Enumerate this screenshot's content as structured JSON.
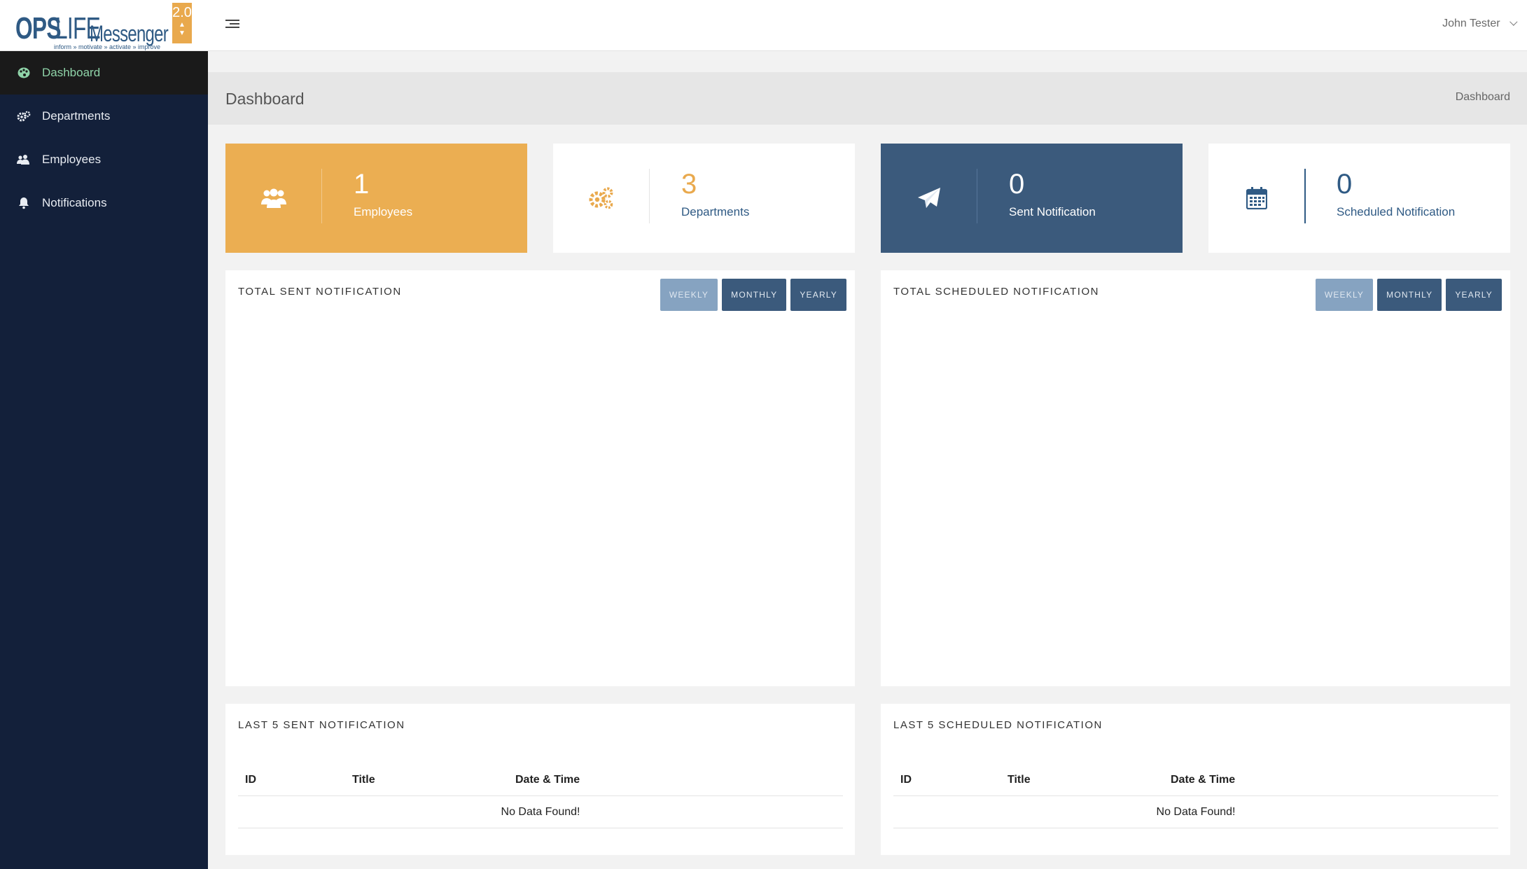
{
  "app": {
    "logo": {
      "ops": "OPS",
      "life": "LIFE",
      "messenger": "Messenger",
      "tagline": "inform » motivate » activate » improve",
      "version": "2.0"
    },
    "user_name": "John Tester"
  },
  "sidebar": {
    "items": [
      {
        "label": "Dashboard",
        "icon": "palette-icon",
        "active": true
      },
      {
        "label": "Departments",
        "icon": "gears-icon",
        "active": false
      },
      {
        "label": "Employees",
        "icon": "users-icon",
        "active": false
      },
      {
        "label": "Notifications",
        "icon": "bell-icon",
        "active": false
      }
    ]
  },
  "page": {
    "title": "Dashboard",
    "breadcrumb": "Dashboard"
  },
  "stats": [
    {
      "value": "1",
      "label": "Employees",
      "icon": "users-icon",
      "color": "#ebae52"
    },
    {
      "value": "3",
      "label": "Departments",
      "icon": "gears-icon",
      "color": "#ffffff"
    },
    {
      "value": "0",
      "label": "Sent Notification",
      "icon": "paper-plane-icon",
      "color": "#3b5a7c"
    },
    {
      "value": "0",
      "label": "Scheduled Notification",
      "icon": "calendar-icon",
      "color": "#ffffff"
    }
  ],
  "charts": {
    "sent": {
      "title": "TOTAL SENT NOTIFICATION",
      "buttons": [
        "WEEKLY",
        "MONTHLY",
        "YEARLY"
      ]
    },
    "scheduled": {
      "title": "TOTAL SCHEDULED NOTIFICATION",
      "buttons": [
        "WEEKLY",
        "MONTHLY",
        "YEARLY"
      ]
    }
  },
  "tables": {
    "sent": {
      "title": "LAST 5 SENT NOTIFICATION",
      "columns": [
        "ID",
        "Title",
        "Date & Time"
      ],
      "empty": "No Data Found!"
    },
    "scheduled": {
      "title": "LAST 5 SCHEDULED NOTIFICATION",
      "columns": [
        "ID",
        "Title",
        "Date & Time"
      ],
      "empty": "No Data Found!"
    }
  },
  "colors": {
    "sidebar": "#13203a",
    "accent_orange": "#ebae52",
    "accent_blue": "#3b5a7c",
    "active_nav_text": "#8fd3a8"
  }
}
